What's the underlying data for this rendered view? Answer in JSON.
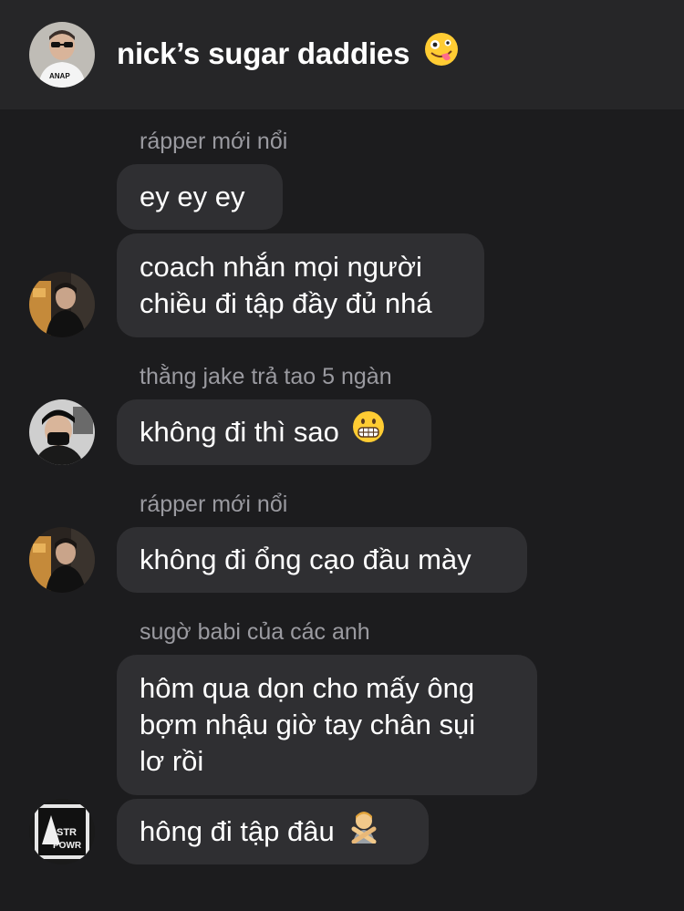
{
  "header": {
    "title": "nick’s sugar daddies",
    "title_emoji": "zany-face-icon"
  },
  "messages": [
    {
      "sender": "rápper mới nổi",
      "lines": [
        "ey ey ey"
      ],
      "avatar": null
    },
    {
      "sender": null,
      "lines": [
        "coach nhắn mọi người",
        "chiều đi tập đầy đủ nhá"
      ],
      "avatar": "rapper-avatar"
    },
    {
      "sender": "thằng jake trả tao 5 ngàn",
      "lines": [
        "không đi thì sao"
      ],
      "emoji": "grimacing-face-icon",
      "avatar": "jake-avatar"
    },
    {
      "sender": "rápper mới nổi",
      "lines": [
        "không đi ổng cạo đầu mày"
      ],
      "avatar": "rapper-avatar"
    },
    {
      "sender": "sugờ babi của các anh",
      "lines": [
        "hôm qua dọn cho mấy ông",
        "bợm nhậu giờ tay chân sụi",
        "lơ rồi"
      ],
      "avatar": null
    },
    {
      "sender": null,
      "lines": [
        "hông đi tập đâu"
      ],
      "emoji": "person-gesturing-no-icon",
      "avatar": "babi-avatar"
    }
  ],
  "colors": {
    "background": "#1c1c1e",
    "header": "#262628",
    "bubble": "#2f2f32",
    "sender_text": "#9a9aa0",
    "text": "#ffffff"
  }
}
